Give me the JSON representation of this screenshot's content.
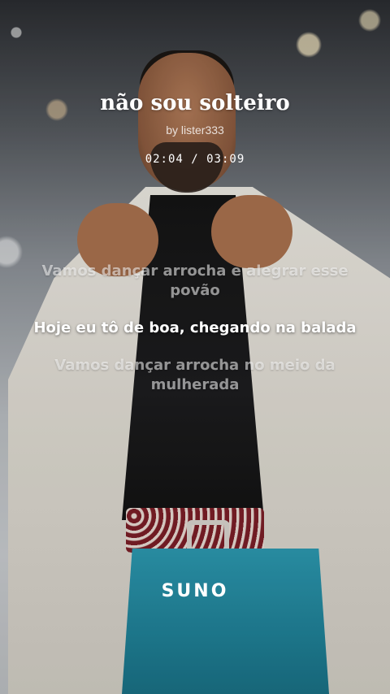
{
  "song": {
    "title": "não sou solteiro",
    "artist": "by lister333",
    "time": "02:04 / 03:09"
  },
  "lyrics": [
    {
      "text": "Vamos dançar arrocha e alegrar esse povão",
      "active": false
    },
    {
      "text": "Hoje eu tô de boa, chegando na balada",
      "active": true
    },
    {
      "text": "Vamos dançar arrocha no meio da mulherada",
      "active": false
    }
  ],
  "brand": "SUNO"
}
